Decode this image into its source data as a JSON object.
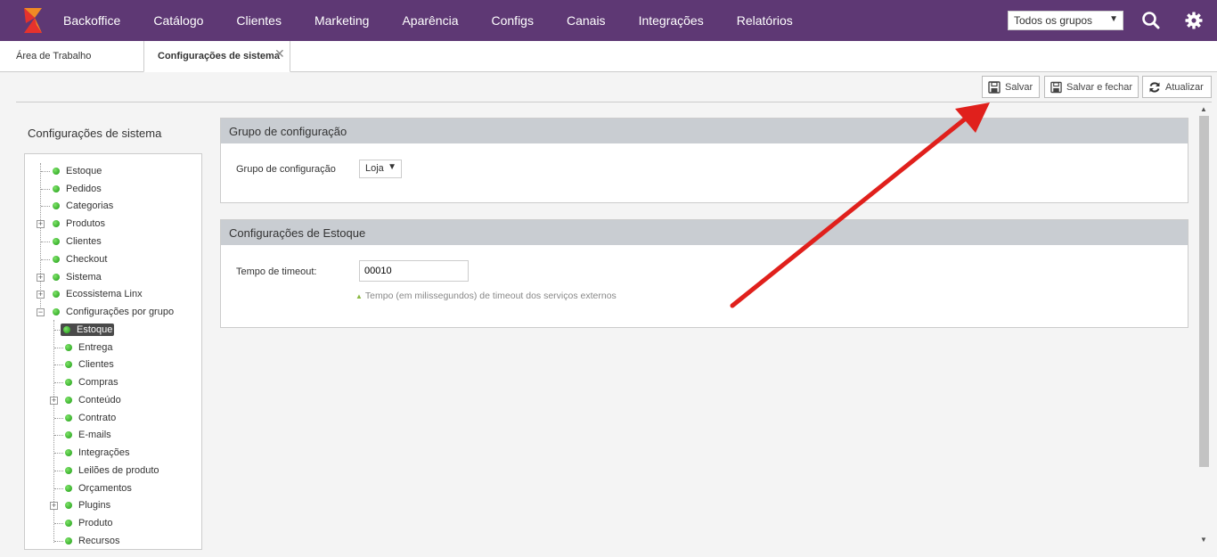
{
  "topbar": {
    "nav": [
      "Backoffice",
      "Catálogo",
      "Clientes",
      "Marketing",
      "Aparência",
      "Configs",
      "Canais",
      "Integrações",
      "Relatórios"
    ],
    "group_select": "Todos os grupos",
    "icons": [
      "search-icon",
      "gear-icon"
    ]
  },
  "tabs": {
    "home": "Área de Trabalho",
    "active": "Configurações de sistema",
    "close": "✕"
  },
  "toolbar": {
    "save": "Salvar",
    "save_close": "Salvar e fechar",
    "refresh": "Atualizar"
  },
  "sidebar": {
    "title": "Configurações de sistema",
    "items": [
      {
        "label": "Estoque"
      },
      {
        "label": "Pedidos"
      },
      {
        "label": "Categorias"
      },
      {
        "label": "Produtos"
      },
      {
        "label": "Clientes"
      },
      {
        "label": "Checkout"
      },
      {
        "label": "Sistema"
      },
      {
        "label": "Ecossistema Linx"
      },
      {
        "label": "Configurações por grupo"
      }
    ],
    "subitems": [
      {
        "label": "Estoque"
      },
      {
        "label": "Entrega"
      },
      {
        "label": "Clientes"
      },
      {
        "label": "Compras"
      },
      {
        "label": "Conteúdo"
      },
      {
        "label": "Contrato"
      },
      {
        "label": "E-mails"
      },
      {
        "label": "Integrações"
      },
      {
        "label": "Leilões de produto"
      },
      {
        "label": "Orçamentos"
      },
      {
        "label": "Plugins"
      },
      {
        "label": "Produto"
      },
      {
        "label": "Recursos"
      }
    ]
  },
  "group_panel": {
    "title": "Grupo de configuração",
    "field_label": "Grupo de configuração",
    "field_value": "Loja"
  },
  "stock_panel": {
    "title": "Configurações de Estoque",
    "field_label": "Tempo de timeout:",
    "field_value": "00010",
    "hint": "Tempo (em milissegundos) de timeout dos serviços externos"
  },
  "colors": {
    "topbar": "#5e3874",
    "panel_head": "#c9cdd2",
    "arrow": "#e0201c"
  }
}
